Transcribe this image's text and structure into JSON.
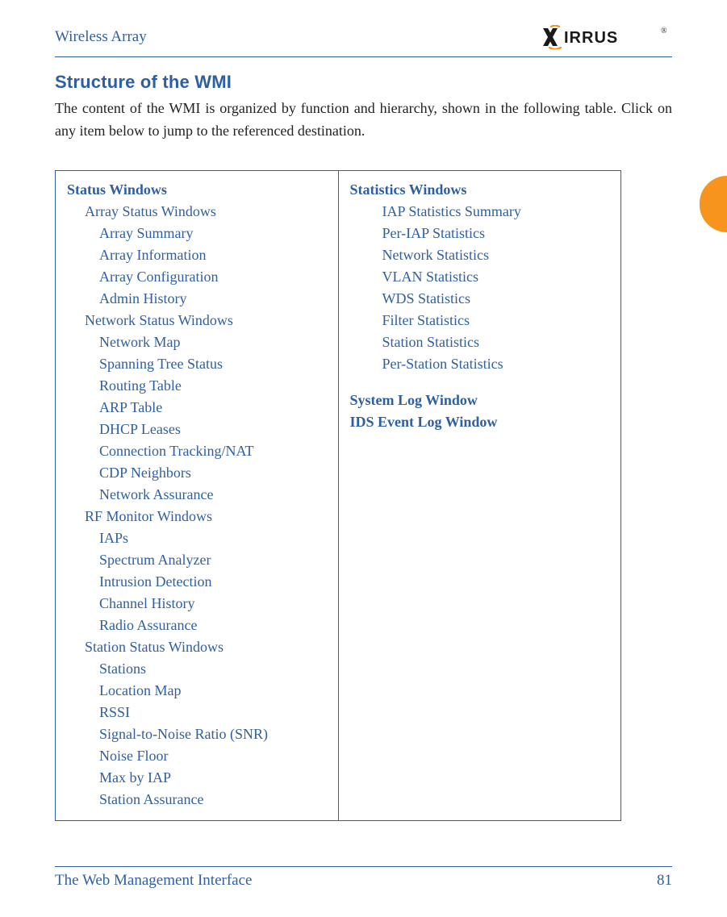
{
  "header": {
    "product": "Wireless Array",
    "logo_alt": "XIRRUS"
  },
  "section": {
    "heading": "Structure of the WMI",
    "intro": "The content of the WMI is organized by function and hierarchy, shown in the following table. Click on any item below to jump to the referenced destination."
  },
  "nav": {
    "left": [
      {
        "level": 0,
        "bold": true,
        "text": "Status Windows"
      },
      {
        "level": 1,
        "text": "Array Status Windows"
      },
      {
        "level": 2,
        "text": "Array Summary"
      },
      {
        "level": 2,
        "text": "Array Information"
      },
      {
        "level": 2,
        "text": "Array Configuration"
      },
      {
        "level": 2,
        "text": "Admin History"
      },
      {
        "level": 1,
        "text": "Network Status Windows"
      },
      {
        "level": 2,
        "text": "Network Map"
      },
      {
        "level": 2,
        "text": "Spanning Tree Status"
      },
      {
        "level": 2,
        "text": "Routing Table"
      },
      {
        "level": 2,
        "text": "ARP Table"
      },
      {
        "level": 2,
        "text": "DHCP Leases"
      },
      {
        "level": 2,
        "text": "Connection Tracking/NAT"
      },
      {
        "level": 2,
        "text": "CDP Neighbors"
      },
      {
        "level": 2,
        "text": "Network Assurance"
      },
      {
        "level": 1,
        "text": "RF Monitor Windows"
      },
      {
        "level": 2,
        "text": "IAPs"
      },
      {
        "level": 2,
        "text": "Spectrum Analyzer"
      },
      {
        "level": 2,
        "text": "Intrusion Detection"
      },
      {
        "level": 2,
        "text": "Channel History"
      },
      {
        "level": 2,
        "text": "Radio Assurance"
      },
      {
        "level": 1,
        "text": "Station Status Windows"
      },
      {
        "level": 2,
        "text": "Stations"
      },
      {
        "level": 2,
        "text": "Location Map"
      },
      {
        "level": 2,
        "text": "RSSI"
      },
      {
        "level": 2,
        "text": "Signal-to-Noise Ratio (SNR)"
      },
      {
        "level": 2,
        "text": "Noise Floor"
      },
      {
        "level": 2,
        "text": "Max by IAP"
      },
      {
        "level": 2,
        "text": "Station Assurance"
      }
    ],
    "right": [
      {
        "level": 0,
        "bold": true,
        "text": "Statistics Windows"
      },
      {
        "level": 2,
        "text": "IAP Statistics Summary"
      },
      {
        "level": 2,
        "text": "Per-IAP Statistics"
      },
      {
        "level": 2,
        "text": "Network Statistics"
      },
      {
        "level": 2,
        "text": "VLAN Statistics"
      },
      {
        "level": 2,
        "text": "WDS Statistics"
      },
      {
        "level": 2,
        "text": "Filter Statistics"
      },
      {
        "level": 2,
        "text": "Station Statistics"
      },
      {
        "level": 2,
        "text": "Per-Station Statistics"
      },
      {
        "level": 0,
        "bold": true,
        "topGap": true,
        "text": "System Log Window"
      },
      {
        "level": 0,
        "bold": true,
        "text": "IDS Event Log Window"
      }
    ]
  },
  "footer": {
    "section_title": "The Web Management Interface",
    "page_number": "81"
  }
}
